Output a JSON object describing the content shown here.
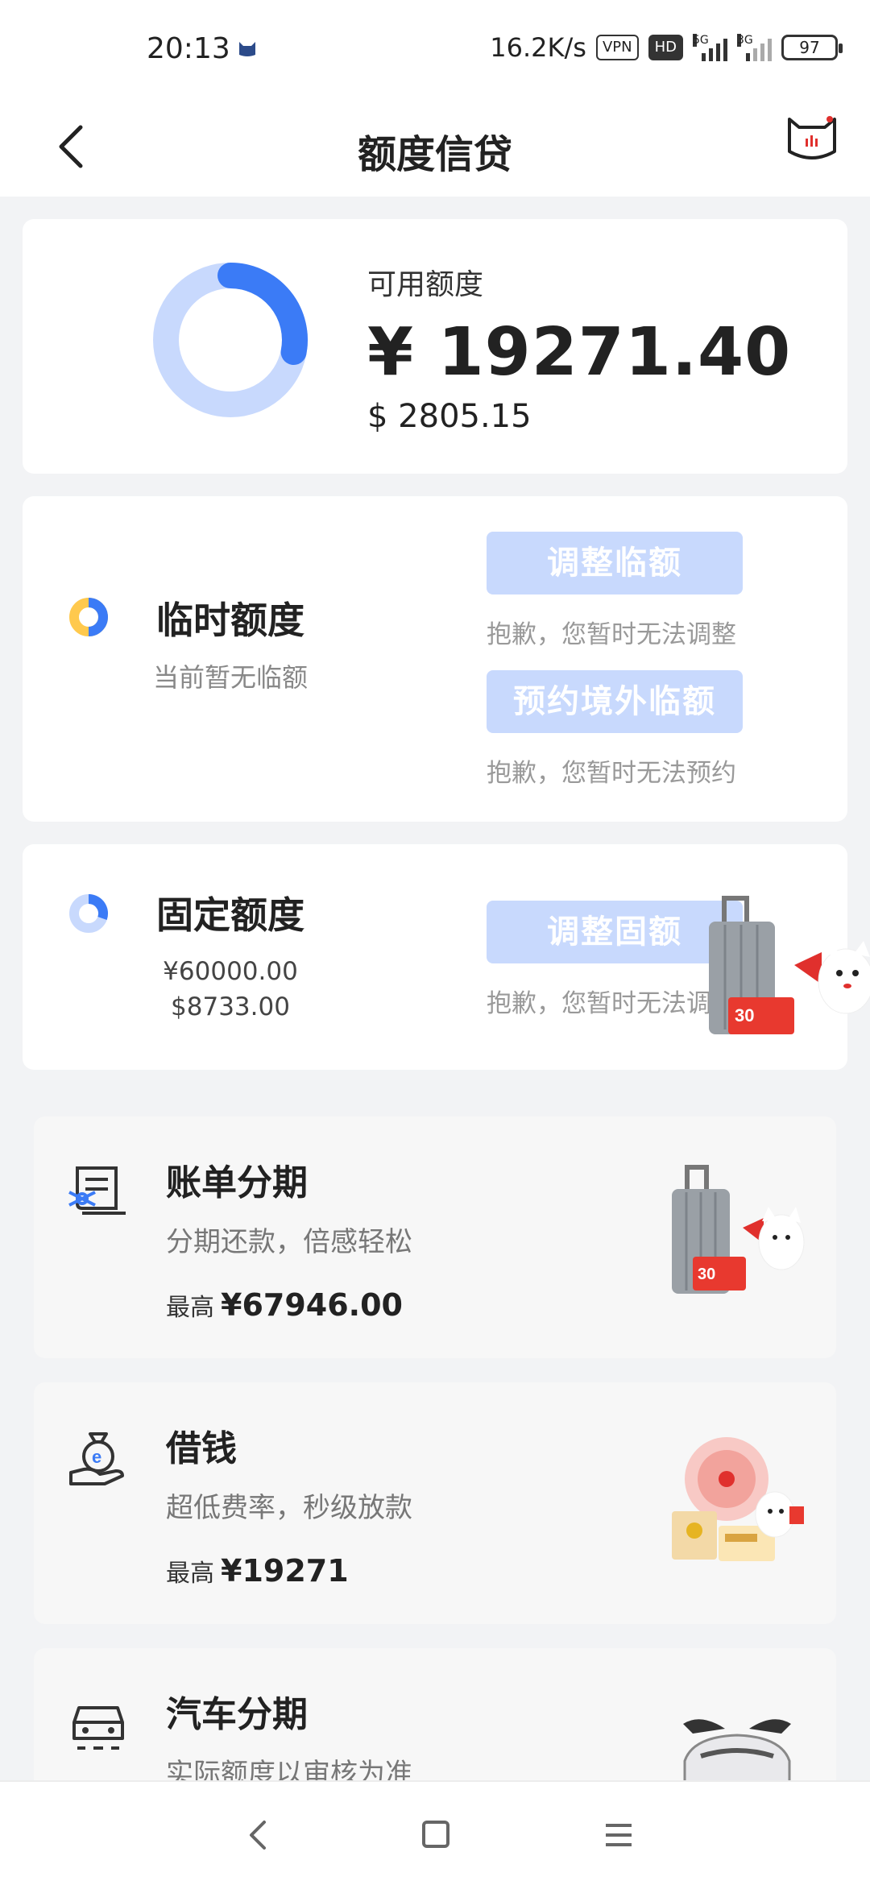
{
  "status_bar": {
    "time": "20:13",
    "net_speed": "16.2K/s",
    "vpn": "VPN",
    "hd": "HD",
    "sig1": "5G",
    "sig2": "3G",
    "battery": "97"
  },
  "header": {
    "title": "额度信贷"
  },
  "available": {
    "label": "可用额度",
    "cny": "¥ 19271.40",
    "usd": "$ 2805.15",
    "used_fraction": 0.28
  },
  "temporary": {
    "title": "临时额度",
    "subtitle": "当前暂无临额",
    "btn1": "调整临额",
    "note1": "抱歉，您暂时无法调整",
    "btn2": "预约境外临额",
    "note2": "抱歉，您暂时无法预约"
  },
  "fixed": {
    "title": "固定额度",
    "cny": "¥60000.00",
    "usd": "$8733.00",
    "btn": "调整固额",
    "note": "抱歉，您暂时无法调"
  },
  "features": [
    {
      "title": "账单分期",
      "subtitle": "分期还款，倍感轻松",
      "max_label": "最高",
      "max_value": "¥67946.00"
    },
    {
      "title": "借钱",
      "subtitle": "超低费率，秒级放款",
      "max_label": "最高",
      "max_value": "¥19271"
    },
    {
      "title": "汽车分期",
      "subtitle": "实际额度以审核为准",
      "max_label": "",
      "max_value": ""
    }
  ],
  "colors": {
    "accent": "#3b7bf6",
    "accent_light": "#c8d9fd",
    "yellow": "#ffc94d"
  }
}
